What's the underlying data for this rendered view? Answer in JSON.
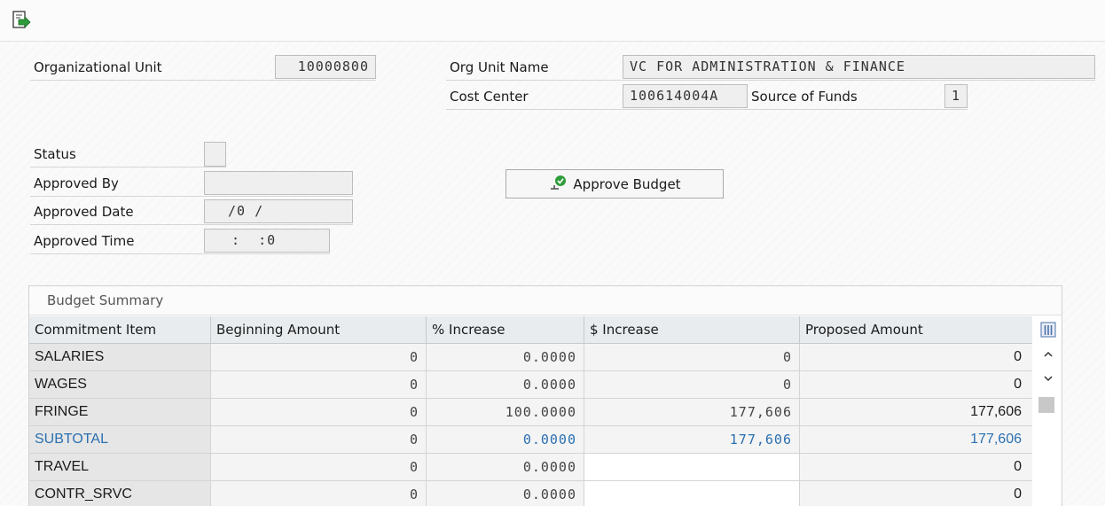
{
  "header": {
    "org_unit_label": "Organizational Unit",
    "org_unit_value": "10000800",
    "org_unit_name_label": "Org Unit Name",
    "org_unit_name_value": "VC FOR ADMINISTRATION & FINANCE",
    "cost_center_label": "Cost Center",
    "cost_center_value": "100614004A",
    "source_of_funds_label": "Source of Funds",
    "source_of_funds_value": "1"
  },
  "approval": {
    "status_label": "Status",
    "status_value": "",
    "approved_by_label": "Approved By",
    "approved_by_value": "",
    "approved_date_label": "Approved Date",
    "approved_date_value": "/0 /",
    "approved_time_label": "Approved Time",
    "approved_time_value": ":  :0",
    "approve_button_label": "Approve Budget"
  },
  "table": {
    "title": "Budget Summary",
    "columns": [
      "Commitment Item",
      "Beginning Amount",
      "% Increase",
      "$ Increase",
      "Proposed Amount"
    ],
    "rows": [
      {
        "item": "SALARIES",
        "beginning": "0",
        "pct": "0.0000",
        "inc": "0",
        "proposed": "0"
      },
      {
        "item": "WAGES",
        "beginning": "0",
        "pct": "0.0000",
        "inc": "0",
        "proposed": "0"
      },
      {
        "item": "FRINGE",
        "beginning": "0",
        "pct": "100.0000",
        "inc": "177,606",
        "proposed": "177,606"
      },
      {
        "item": "SUBTOTAL",
        "beginning": "0",
        "pct": "0.0000",
        "inc": "177,606",
        "proposed": "177,606"
      },
      {
        "item": "TRAVEL",
        "beginning": "0",
        "pct": "0.0000",
        "inc": "",
        "proposed": "0"
      },
      {
        "item": "CONTR_SRVC",
        "beginning": "0",
        "pct": "0.0000",
        "inc": "",
        "proposed": "0"
      }
    ]
  },
  "colors": {
    "subtotal_text": "#2a6fb0",
    "approve_check": "#2e9c3b"
  },
  "icons": {
    "toolbar": "export-document-icon",
    "approve": "approve-check-icon",
    "column_settings": "column-settings-icon",
    "scroll_up": "chevron-up-icon",
    "scroll_down": "chevron-down-icon"
  }
}
